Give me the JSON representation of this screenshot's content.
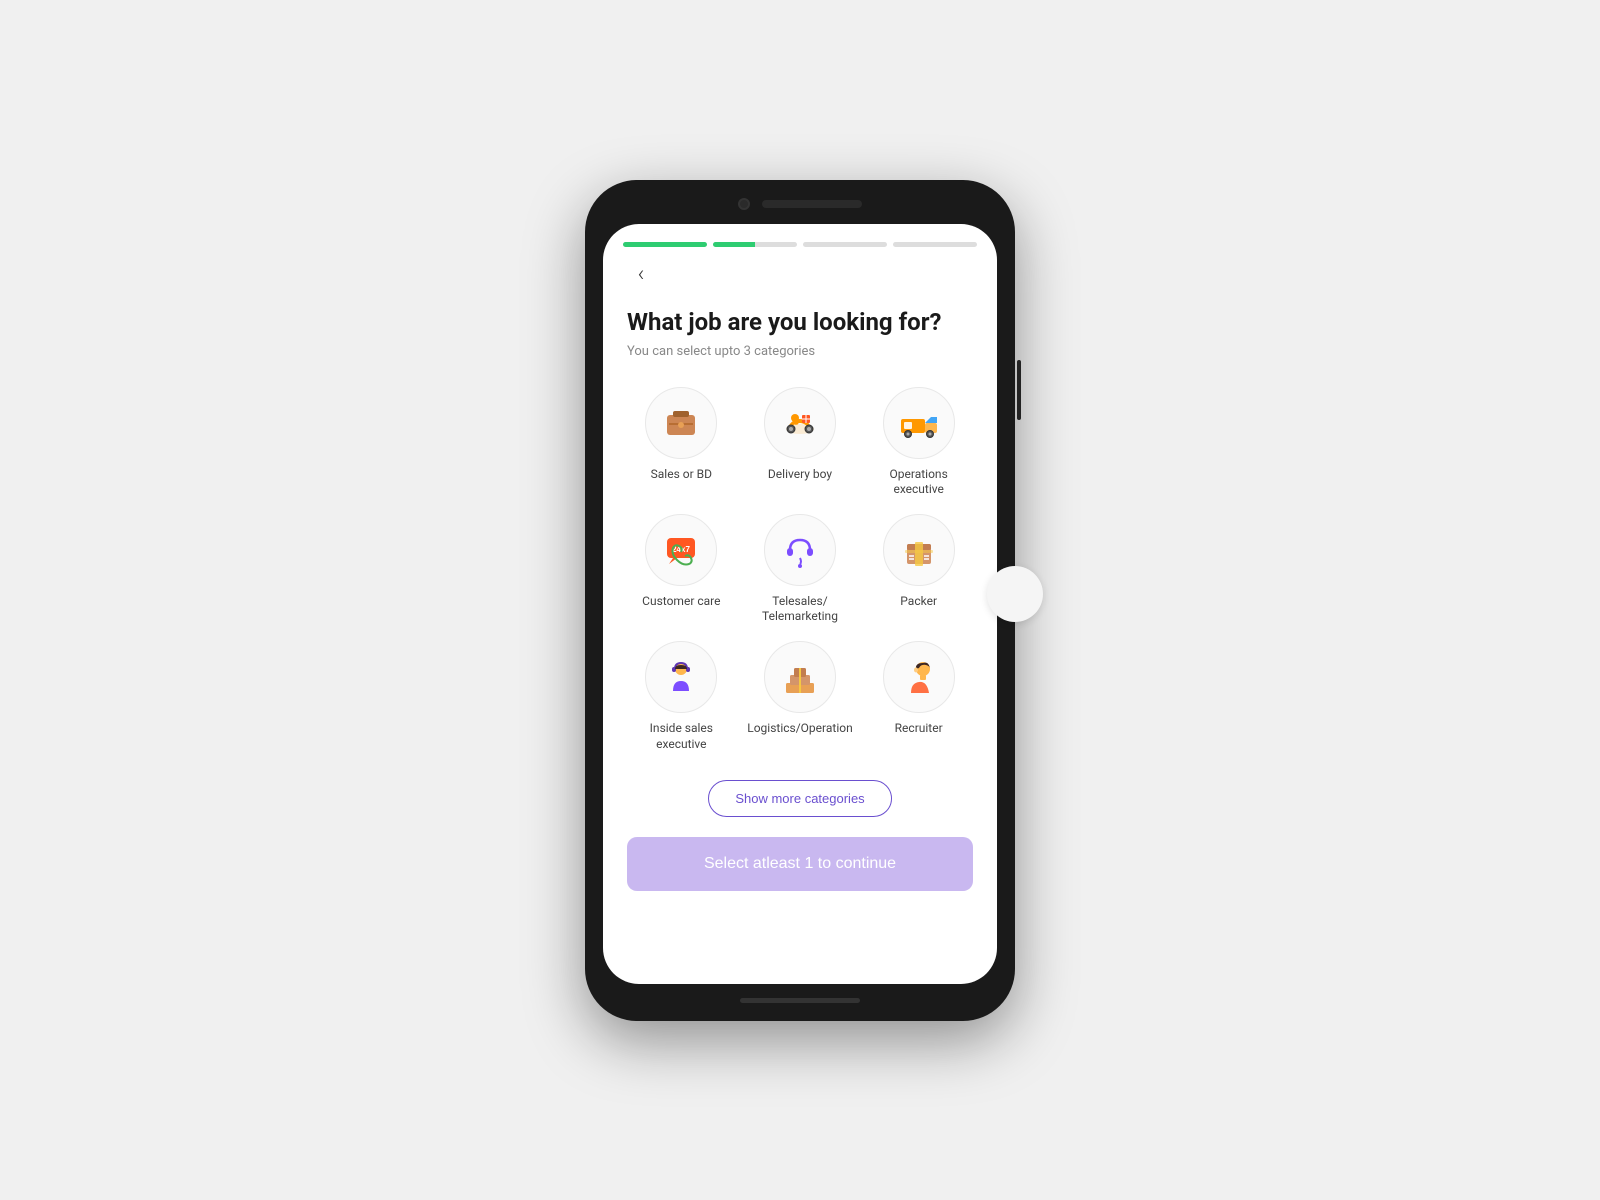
{
  "progress": {
    "segments": [
      {
        "color": "#2ecc71",
        "active": true
      },
      {
        "color": "#2ecc71",
        "active": true,
        "partial": true
      },
      {
        "color": "#ddd",
        "active": false
      },
      {
        "color": "#ddd",
        "active": false
      }
    ]
  },
  "page": {
    "title": "What job are you looking for?",
    "subtitle": "You can select upto 3 categories",
    "back_label": "‹"
  },
  "categories": [
    {
      "id": "sales-bd",
      "label": "Sales or BD",
      "icon": "briefcase"
    },
    {
      "id": "delivery-boy",
      "label": "Delivery boy",
      "icon": "delivery"
    },
    {
      "id": "operations-executive",
      "label": "Operations executive",
      "icon": "truck"
    },
    {
      "id": "customer-care",
      "label": "Customer care",
      "icon": "phone-24x7"
    },
    {
      "id": "telesales",
      "label": "Telesales/ Telemarketing",
      "icon": "headset"
    },
    {
      "id": "packer",
      "label": "Packer",
      "icon": "box"
    },
    {
      "id": "inside-sales",
      "label": "Inside sales executive",
      "icon": "person-headset"
    },
    {
      "id": "logistics",
      "label": "Logistics/Operation",
      "icon": "boxes"
    },
    {
      "id": "recruiter",
      "label": "Recruiter",
      "icon": "recruiter"
    }
  ],
  "show_more_label": "Show more categories",
  "continue_label": "Select atleast 1 to continue"
}
